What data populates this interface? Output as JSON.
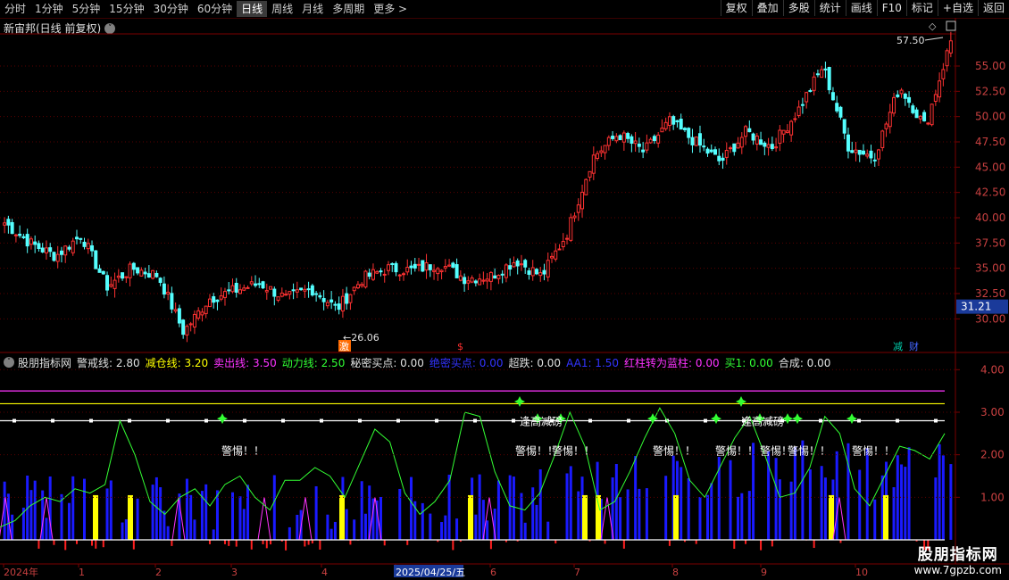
{
  "toolbar": {
    "periods": [
      "分时",
      "1分钟",
      "5分钟",
      "15分钟",
      "30分钟",
      "60分钟",
      "日线",
      "周线",
      "月线",
      "多周期",
      "更多"
    ],
    "active_period": "日线",
    "more_arrow": ">",
    "right_buttons": [
      "复权",
      "叠加",
      "多股",
      "统计",
      "画线",
      "F10",
      "标记",
      "+自选",
      "返回"
    ]
  },
  "main_chart": {
    "title": "新宙邦(日线 前复权)",
    "price_axis": [
      "55.00",
      "52.50",
      "50.00",
      "47.50",
      "45.00",
      "42.50",
      "40.00",
      "37.50",
      "35.00",
      "32.50",
      "30.00"
    ],
    "current_price": "31.21",
    "high_label": "57.50",
    "low_label": "26.06",
    "markers": [
      "激",
      "$",
      "减",
      "财"
    ]
  },
  "indicator": {
    "name": "股朋指标网",
    "fields": [
      {
        "label": "警戒线: 2.80",
        "color": "#e0e0e0"
      },
      {
        "label": "减仓线: 3.20",
        "color": "#ffff00"
      },
      {
        "label": "卖出线: 3.50",
        "color": "#ff33ff"
      },
      {
        "label": "动力线: 2.50",
        "color": "#33ff33"
      },
      {
        "label": "秘密买点: 0.00",
        "color": "#e0e0e0"
      },
      {
        "label": "绝密买点: 0.00",
        "color": "#3333ff"
      },
      {
        "label": "超跌: 0.00",
        "color": "#e0e0e0"
      },
      {
        "label": "AA1: 1.50",
        "color": "#3333ff"
      },
      {
        "label": "红柱转为蓝柱: 0.00",
        "color": "#ff33ff"
      },
      {
        "label": "买1: 0.00",
        "color": "#33ff33"
      },
      {
        "label": "合成: 0.00",
        "color": "#e0e0e0"
      }
    ],
    "axis": [
      "4.00",
      "3.00",
      "2.00",
      "1.00"
    ],
    "annotations": {
      "alert": "警惕！！",
      "reduce": "逢高减磅"
    }
  },
  "date_axis": {
    "labels": [
      "2024年",
      "1",
      "2",
      "3",
      "4",
      "2025/04/25/五",
      "6",
      "7",
      "8",
      "9",
      "10"
    ]
  },
  "watermark": {
    "title": "股朋指标网",
    "url": "www.7gpzb.com"
  },
  "colors": {
    "up": "#ff3232",
    "down": "#54ffff",
    "grid": "#5a0000",
    "white_line": "#ffffff",
    "yellow_line": "#ffff00",
    "magenta_line": "#ff33ff",
    "green_line": "#33ff33",
    "blue_bar": "#1a1aff"
  },
  "chart_data": [
    {
      "type": "line",
      "title": "新宙邦(日线 前复权)",
      "ylim": [
        28,
        58
      ],
      "x": [
        "2024年",
        "1",
        "2",
        "3",
        "4",
        "2025/04/25",
        "6",
        "7",
        "8",
        "9",
        "10"
      ],
      "series": [
        {
          "values": [
            39.5,
            37.5,
            36.2,
            38.3,
            33.2,
            35.0,
            34.3,
            28.7,
            32.0,
            32.8,
            33.5,
            32.0,
            33.0,
            31.0,
            34.0,
            35.0,
            34.8,
            35.5,
            34.0,
            34.2,
            35.8,
            34.2,
            38.5,
            46.0,
            48.3,
            46.5,
            49.5,
            47.5,
            45.5,
            48.5,
            47.0,
            50.5,
            55.0,
            47.0,
            46.0,
            53.0,
            49.0,
            57.5
          ]
        }
      ]
    }
  ]
}
